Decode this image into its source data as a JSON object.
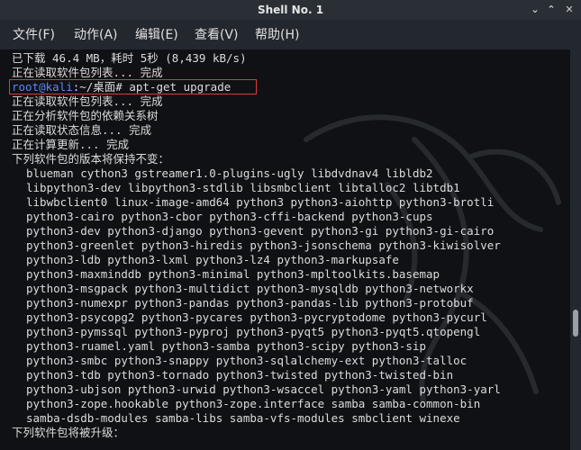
{
  "window": {
    "title": "Shell No. 1"
  },
  "window_controls": {
    "minimize": "⌄",
    "maximize": "⌃",
    "close": "✕"
  },
  "menu": {
    "file": "文件(F)",
    "action": "动作(A)",
    "edit": "编辑(E)",
    "view": "查看(V)",
    "help": "帮助(H)"
  },
  "terminal": {
    "lines": [
      "已下载 46.4 MB，耗时 5秒 (8,439 kB/s)",
      "正在读取软件包列表... 完成",
      "",
      "正在读取软件包列表... 完成",
      "正在分析软件包的依赖关系树",
      "正在读取状态信息... 完成",
      "正在计算更新... 完成",
      "下列软件包的版本将保持不变：",
      "blueman cython3 gstreamer1.0-plugins-ugly libdvdnav4 libldb2",
      "libpython3-dev libpython3-stdlib libsmbclient libtalloc2 libtdb1",
      "libwbclient0 linux-image-amd64 python3 python3-aiohttp python3-brotli",
      "python3-cairo python3-cbor python3-cffi-backend python3-cups",
      "python3-dev python3-django python3-gevent python3-gi python3-gi-cairo",
      "python3-greenlet python3-hiredis python3-jsonschema python3-kiwisolver",
      "python3-ldb python3-lxml python3-lz4 python3-markupsafe",
      "python3-maxminddb python3-minimal python3-mpltoolkits.basemap",
      "python3-msgpack python3-multidict python3-mysqldb python3-networkx",
      "python3-numexpr python3-pandas python3-pandas-lib python3-protobuf",
      "python3-psycopg2 python3-pycares python3-pycryptodome python3-pycurl",
      "python3-pymssql python3-pyproj python3-pyqt5 python3-pyqt5.qtopengl",
      "python3-ruamel.yaml python3-samba python3-scipy python3-sip",
      "python3-smbc python3-snappy python3-sqlalchemy-ext python3-talloc",
      "python3-tdb python3-tornado python3-twisted python3-twisted-bin",
      "python3-ubjson python3-urwid python3-wsaccel python3-yaml python3-yarl",
      "python3-zope.hookable python3-zope.interface samba samba-common-bin",
      "samba-dsdb-modules samba-libs samba-vfs-modules smbclient winexe",
      "下列软件包将被升级："
    ],
    "prompt": {
      "user_host": "root@kali",
      "path": ":~/桌面# ",
      "command": "apt-get upgrade"
    },
    "package_line_start": 8,
    "package_line_end": 25,
    "prompt_line_index": 2
  },
  "scrollbar": {
    "position_fraction": 0.7
  },
  "colors": {
    "background": "#0f1114",
    "text": "#dcdcdc",
    "prompt_user": "#5f87ff",
    "highlight_box": "#e0383c",
    "chrome": "#23272e"
  },
  "icons": {
    "background_logo": "kali-dragon-icon"
  }
}
